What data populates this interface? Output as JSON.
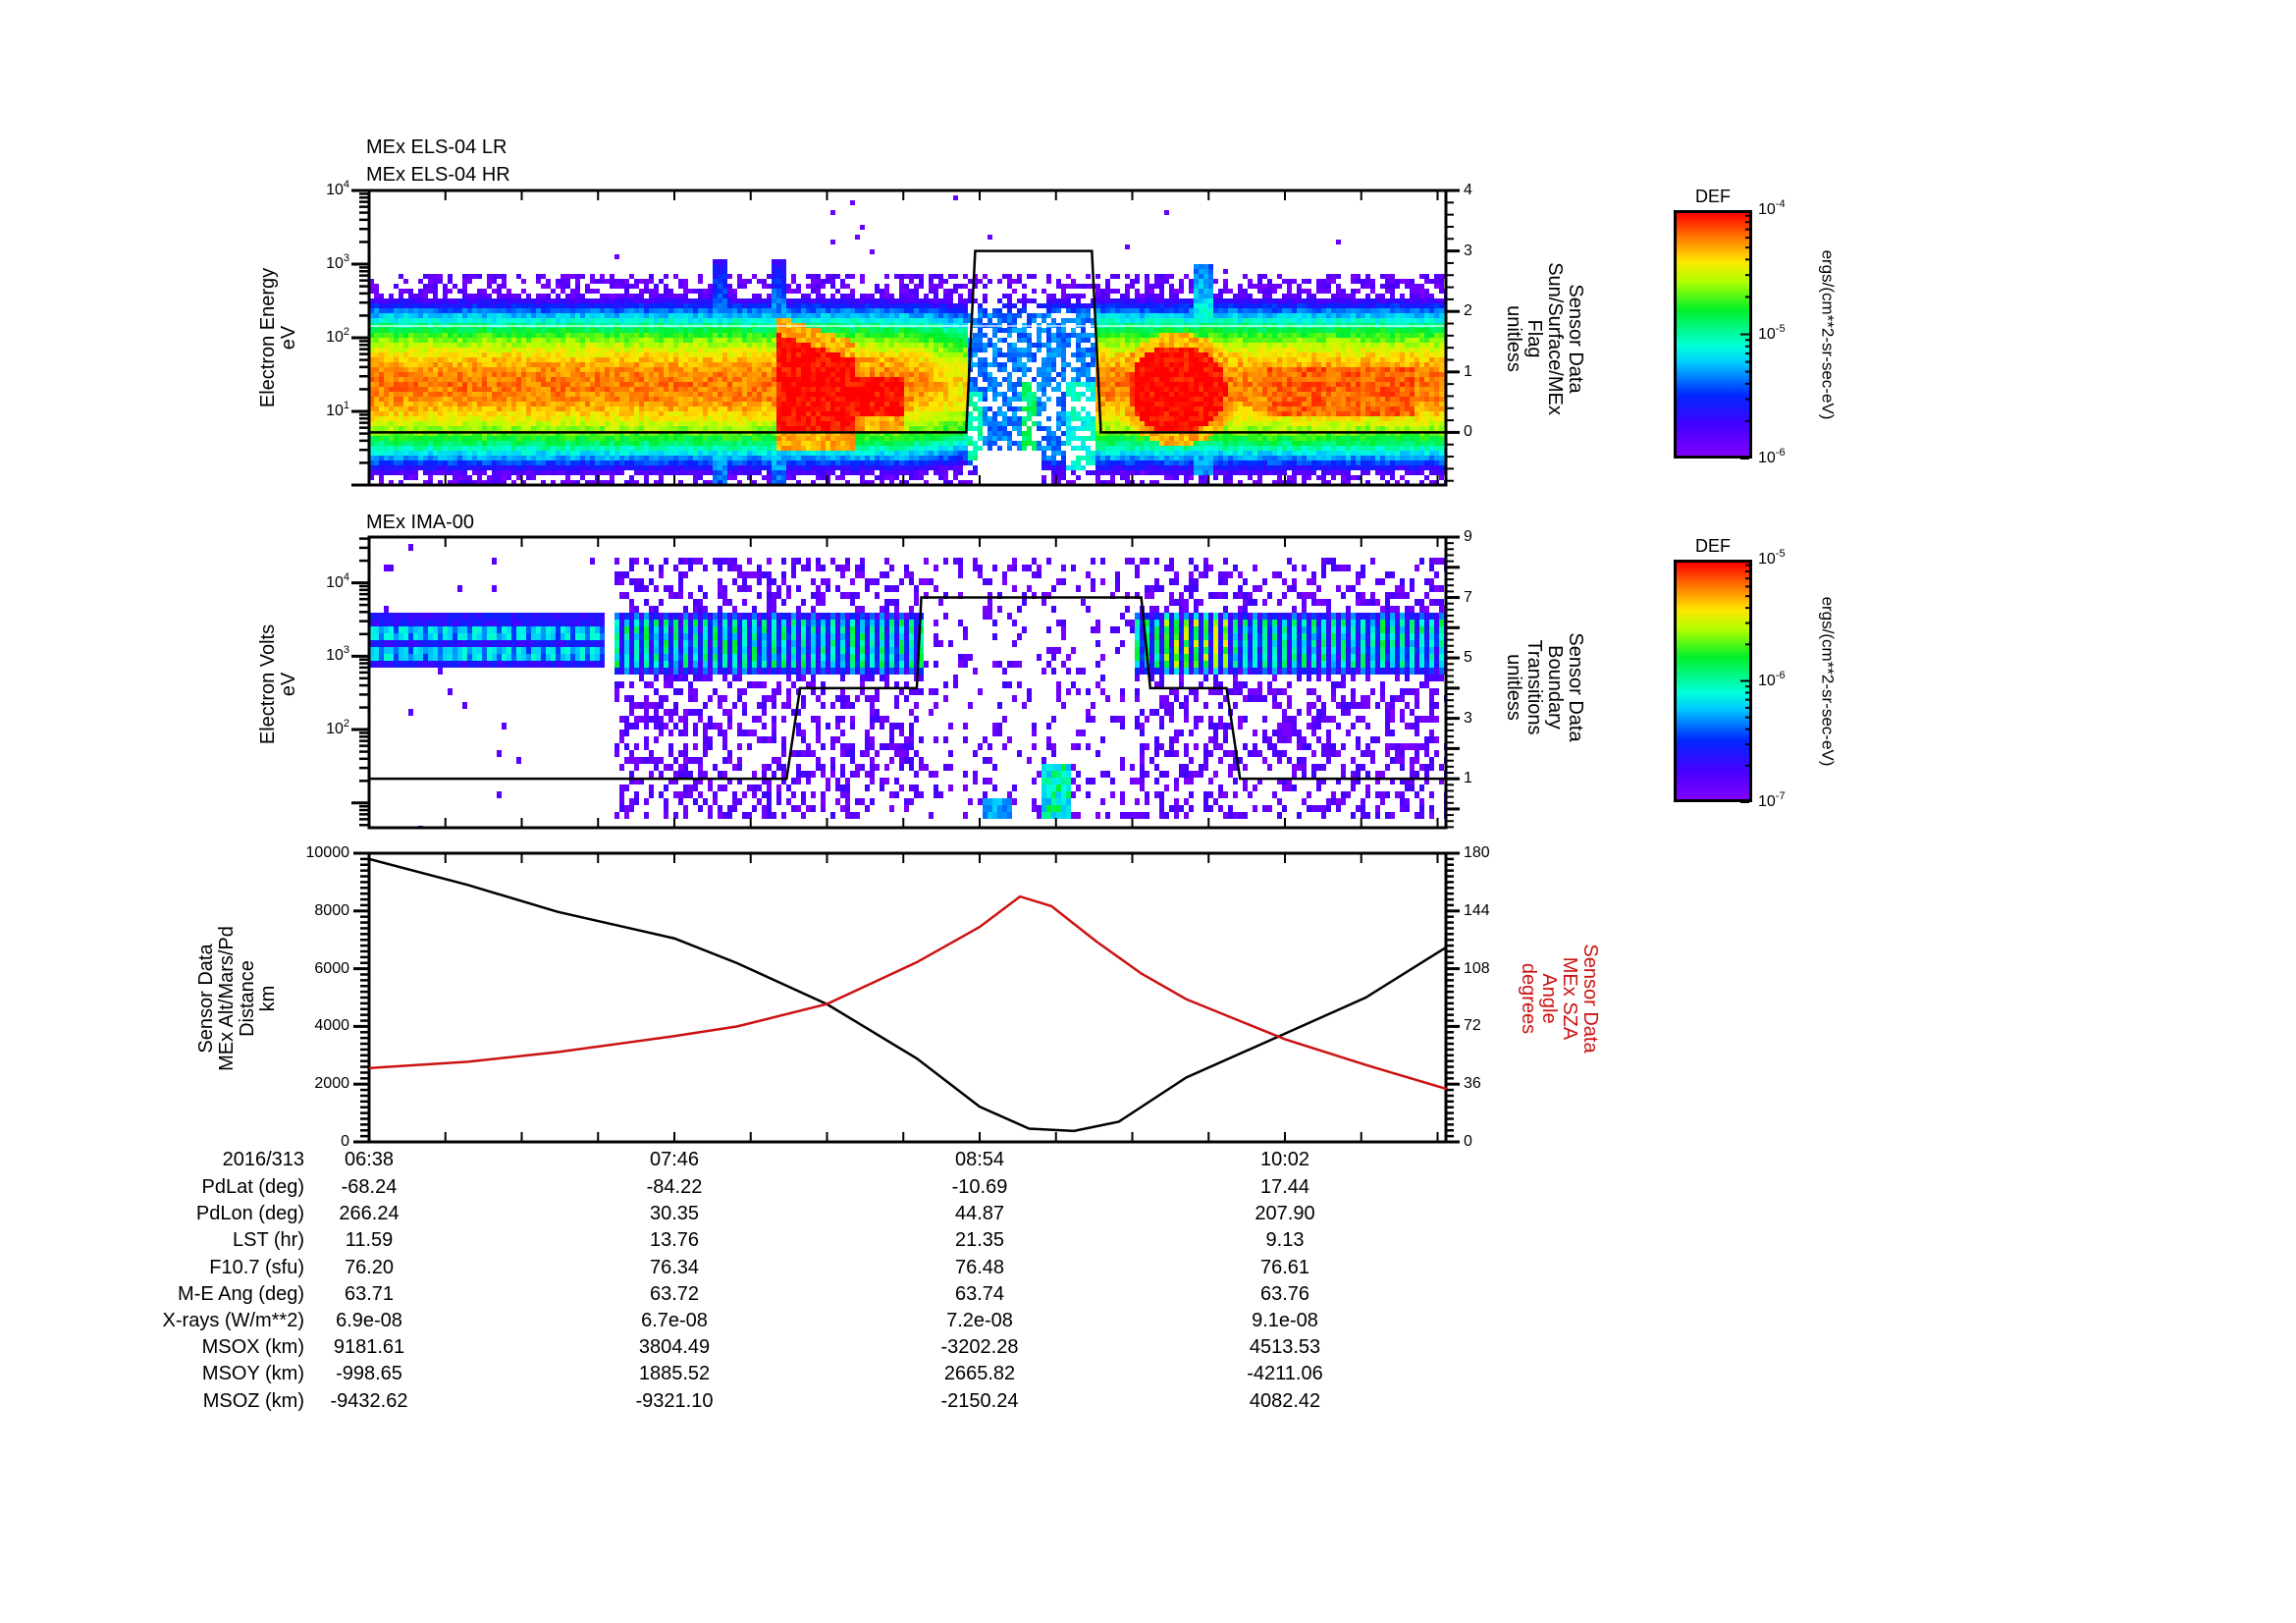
{
  "chart_data": [
    {
      "type": "heatmap",
      "title_lines": [
        "MEx ELS-04 LR",
        "MEx ELS-04 HR"
      ],
      "ylabel_lines": [
        "Electron Energy",
        "eV"
      ],
      "yscale": "log",
      "ylim": [
        1,
        10000
      ],
      "yticks": [
        {
          "m": "10",
          "e": "1"
        },
        {
          "m": "10",
          "e": "2"
        },
        {
          "m": "10",
          "e": "3"
        },
        {
          "m": "10",
          "e": "4"
        }
      ],
      "colormap": "rainbow",
      "right_axis": {
        "label_lines": [
          "Sensor Data",
          "Sun/Surface/MEx",
          "Flag",
          "unitless"
        ],
        "ylim": [
          -0.87,
          4
        ],
        "ticks": [
          "0",
          "1",
          "2",
          "3",
          "4"
        ]
      },
      "overlay_line": {
        "color": "#000000",
        "points": [
          [
            "06:38",
            0
          ],
          [
            "08:51",
            0
          ],
          [
            "08:53",
            3
          ],
          [
            "09:19",
            3
          ],
          [
            "09:21",
            0
          ],
          [
            "10:38",
            0
          ]
        ]
      },
      "colorbar": {
        "title": "DEF",
        "scale": "log",
        "range": [
          1e-06,
          0.0001
        ],
        "ticks": [
          {
            "m": "10",
            "e": "-4"
          },
          {
            "m": "10",
            "e": "-5"
          },
          {
            "m": "10",
            "e": "-6"
          }
        ],
        "units": "ergs/(cm**2-sr-sec-eV)"
      }
    },
    {
      "type": "heatmap",
      "title_lines": [
        "MEx IMA-00"
      ],
      "ylabel_lines": [
        "Electron Volts",
        "eV"
      ],
      "yscale": "log",
      "ylim": [
        4.6,
        42000
      ],
      "yticks": [
        {
          "m": "10",
          "e": "2"
        },
        {
          "m": "10",
          "e": "3"
        },
        {
          "m": "10",
          "e": "4"
        }
      ],
      "colormap": "rainbow",
      "right_axis": {
        "label_lines": [
          "Sensor Data",
          "Boundary",
          "Transitions",
          "unitless"
        ],
        "ylim": [
          -0.62,
          9
        ],
        "ticks": [
          "1",
          "3",
          "5",
          "7",
          "9"
        ]
      },
      "overlay_line": {
        "color": "#000000",
        "points": [
          [
            "06:38",
            1
          ],
          [
            "08:11",
            1
          ],
          [
            "08:14",
            4
          ],
          [
            "08:40",
            4
          ],
          [
            "08:41",
            7
          ],
          [
            "09:30",
            7
          ],
          [
            "09:32",
            4
          ],
          [
            "09:49",
            4
          ],
          [
            "09:52",
            1
          ],
          [
            "10:38",
            1
          ]
        ]
      },
      "colorbar": {
        "title": "DEF",
        "scale": "log",
        "range": [
          1e-07,
          1e-05
        ],
        "ticks": [
          {
            "m": "10",
            "e": "-5"
          },
          {
            "m": "10",
            "e": "-6"
          },
          {
            "m": "10",
            "e": "-7"
          }
        ],
        "units": "ergs/(cm**2-sr-sec-eV)"
      }
    },
    {
      "type": "line",
      "ylabel_lines": [
        "Sensor Data",
        "MEx Alt/Mars/Pd",
        "Distance",
        "km"
      ],
      "ylim": [
        0,
        10000
      ],
      "yticks": [
        "0",
        "2000",
        "4000",
        "6000",
        "8000",
        "10000"
      ],
      "right_axis": {
        "label_lines": [
          "Sensor Data",
          "MEx SZA",
          "Angle",
          "degrees"
        ],
        "color": "#cc1111",
        "ylim": [
          0,
          180
        ],
        "ticks": [
          "0",
          "36",
          "72",
          "108",
          "144",
          "180"
        ]
      },
      "series": [
        {
          "axis": "left",
          "color": "#000000",
          "points": [
            [
              "06:38",
              9800
            ],
            [
              "07:00",
              8900
            ],
            [
              "07:20",
              7970
            ],
            [
              "07:46",
              7050
            ],
            [
              "08:00",
              6190
            ],
            [
              "08:20",
              4770
            ],
            [
              "08:40",
              2890
            ],
            [
              "08:54",
              1220
            ],
            [
              "09:05",
              460
            ],
            [
              "09:15",
              380
            ],
            [
              "09:25",
              700
            ],
            [
              "09:40",
              2230
            ],
            [
              "10:02",
              3750
            ],
            [
              "10:20",
              5000
            ],
            [
              "10:38",
              6750
            ]
          ]
        },
        {
          "axis": "right",
          "color": "#cc1111",
          "points": [
            [
              "06:38",
              46
            ],
            [
              "07:00",
              50
            ],
            [
              "07:20",
              56
            ],
            [
              "07:46",
              66
            ],
            [
              "08:00",
              72
            ],
            [
              "08:20",
              86
            ],
            [
              "08:40",
              112
            ],
            [
              "08:54",
              134
            ],
            [
              "09:03",
              153
            ],
            [
              "09:10",
              147
            ],
            [
              "09:20",
              125
            ],
            [
              "09:30",
              105
            ],
            [
              "09:40",
              89
            ],
            [
              "10:02",
              64
            ],
            [
              "10:20",
              48
            ],
            [
              "10:38",
              33
            ]
          ]
        }
      ]
    }
  ],
  "time_axis": {
    "range": [
      "06:38",
      "10:38"
    ],
    "labels": [
      "06:38",
      "07:46",
      "08:54",
      "10:02"
    ]
  },
  "ephemeris": {
    "date": "2016/313",
    "rows": [
      {
        "label": "PdLat (deg)",
        "values": [
          "-68.24",
          "-84.22",
          "-10.69",
          "17.44"
        ]
      },
      {
        "label": "PdLon (deg)",
        "values": [
          "266.24",
          "30.35",
          "44.87",
          "207.90"
        ]
      },
      {
        "label": "LST (hr)",
        "values": [
          "11.59",
          "13.76",
          "21.35",
          "9.13"
        ]
      },
      {
        "label": "F10.7 (sfu)",
        "values": [
          "76.20",
          "76.34",
          "76.48",
          "76.61"
        ]
      },
      {
        "label": "M-E Ang (deg)",
        "values": [
          "63.71",
          "63.72",
          "63.74",
          "63.76"
        ]
      },
      {
        "label": "X-rays (W/m**2)",
        "values": [
          "6.9e-08",
          "6.7e-08",
          "7.2e-08",
          "9.1e-08"
        ]
      },
      {
        "label": "MSOX (km)",
        "values": [
          "9181.61",
          "3804.49",
          "-3202.28",
          "4513.53"
        ]
      },
      {
        "label": "MSOY (km)",
        "values": [
          "-998.65",
          "1885.52",
          "2665.82",
          "-4211.06"
        ]
      },
      {
        "label": "MSOZ (km)",
        "values": [
          "-9432.62",
          "-9321.10",
          "-2150.24",
          "4082.42"
        ]
      }
    ]
  }
}
